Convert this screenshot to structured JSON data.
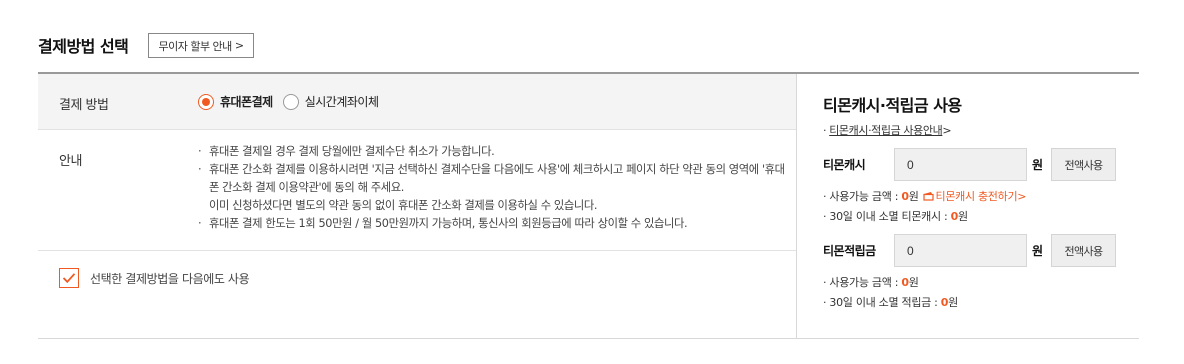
{
  "header": {
    "title": "결제방법 선택",
    "info_button": "무이자 할부 안내",
    "info_button_chevron": ">"
  },
  "method": {
    "label": "결제 방법",
    "options": [
      {
        "label": "휴대폰결제",
        "selected": true
      },
      {
        "label": "실시간계좌이체",
        "selected": false
      }
    ]
  },
  "notice": {
    "label": "안내",
    "items": [
      "휴대폰 결제일 경우 결제 당월에만 결제수단 취소가 가능합니다.",
      "휴대폰 간소화 결제를 이용하시려면 '지금 선택하신 결제수단을 다음에도 사용'에 체크하시고 페이지 하단 약관 동의 영역에 '휴대폰 간소화 결제 이용약관'에 동의 해 주세요.",
      "이미 신청하셨다면 별도의 약관 동의 없이 휴대폰 간소화 결제를 이용하실 수 있습니다.",
      "휴대폰 결제 한도는 1회 50만원 / 월 50만원까지 가능하며, 통신사의 회원등급에 따라 상이할 수 있습니다."
    ]
  },
  "save_method": {
    "label": "선택한 결제방법을 다음에도 사용",
    "checked": true
  },
  "points": {
    "title": "티몬캐시·적립금 사용",
    "guide_link": "티몬캐시·적립금 사용안내",
    "guide_chevron": ">",
    "cash": {
      "label": "티몬캐시",
      "value": "0",
      "unit": "원",
      "use_all": "전액사용",
      "available_prefix": "사용가능 금액 : ",
      "available_value": "0",
      "available_unit": "원",
      "charge_link": "티몬캐시 충전하기",
      "charge_chevron": ">",
      "expiring_prefix": "30일 이내 소멸 티몬캐시 : ",
      "expiring_value": "0",
      "expiring_unit": "원"
    },
    "reward": {
      "label": "티몬적립금",
      "value": "0",
      "unit": "원",
      "use_all": "전액사용",
      "available_prefix": "사용가능 금액 : ",
      "available_value": "0",
      "available_unit": "원",
      "expiring_prefix": "30일 이내 소멸 적립금 : ",
      "expiring_value": "0",
      "expiring_unit": "원"
    }
  },
  "colors": {
    "accent": "#f05a22",
    "panel_bg": "#f4f4f4",
    "rule": "#999999"
  }
}
